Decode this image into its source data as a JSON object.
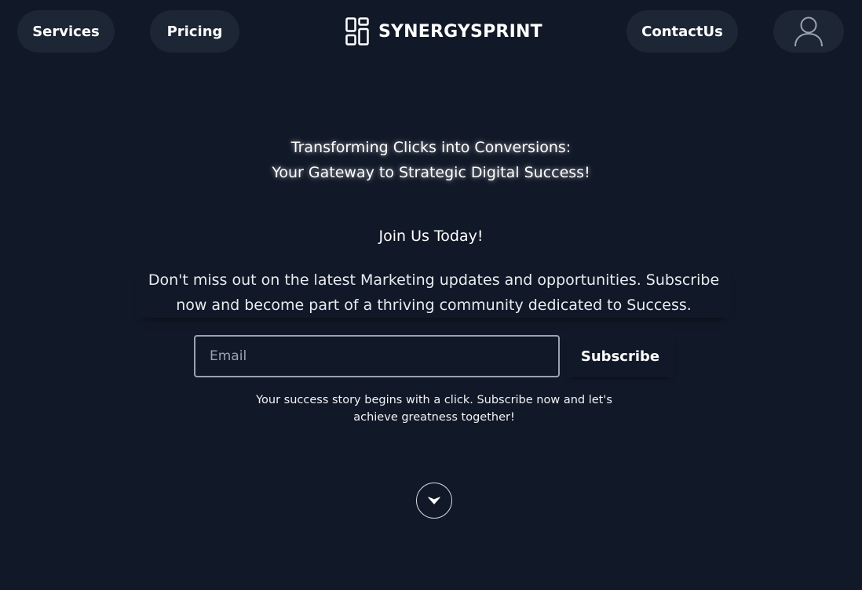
{
  "header": {
    "nav_services": "Services",
    "nav_pricing": "Pricing",
    "brand": "SYNERGYSPRINT",
    "nav_contact": "ContactUs",
    "avatar_icon": "user-avatar-icon"
  },
  "hero": {
    "line1": "Transforming Clicks into Conversions:",
    "line2": "Your Gateway to Strategic Digital Success!"
  },
  "join": {
    "title": "Join Us Today!",
    "description": "Don't miss out on the latest Marketing updates and opportunities. Subscribe now and become part of a thriving community dedicated to Success.",
    "email_placeholder": "Email",
    "subscribe_label": "Subscribe",
    "note": "Your success story begins with a click. Subscribe now and let's achieve greatness together!"
  },
  "scroll": {
    "icon": "chevron-down-icon"
  },
  "colors": {
    "background": "#111827",
    "pill": "#1d2634",
    "input_border": "#9ca3af"
  }
}
